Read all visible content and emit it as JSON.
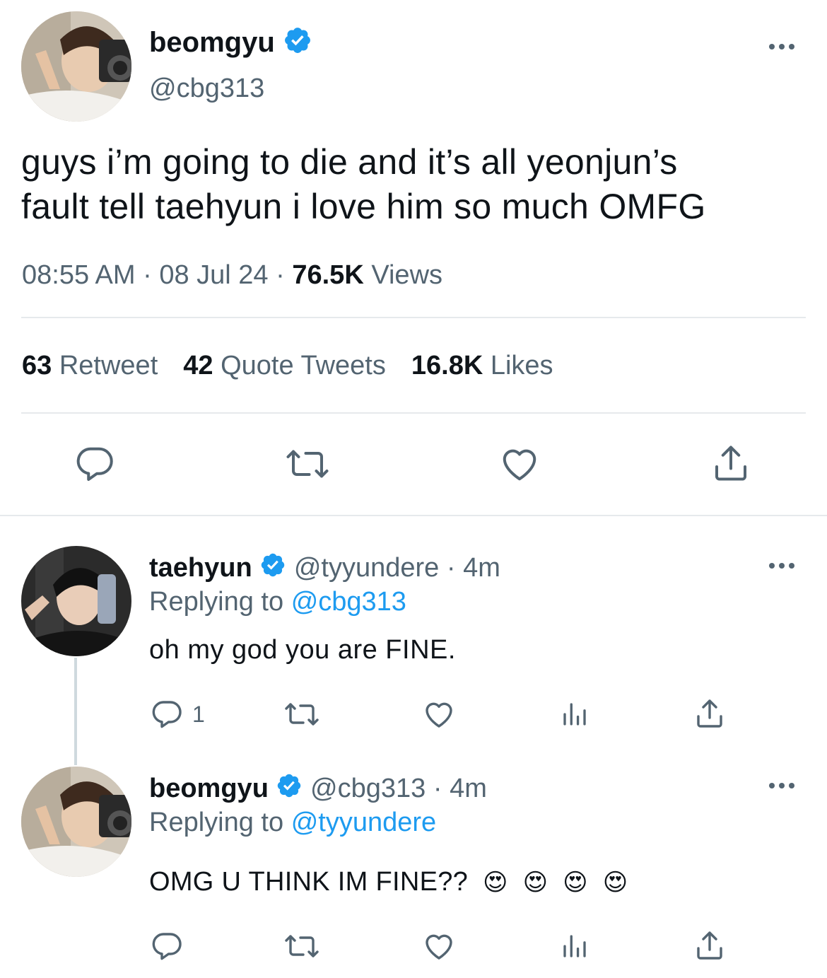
{
  "main_tweet": {
    "display_name": "beomgyu",
    "handle": "@cbg313",
    "text_line1": "guys i’m going to die and it’s all yeonjun’s",
    "text_line2": "fault tell taehyun i love him so much OMFG",
    "time": "08:55 AM",
    "sep1": "·",
    "date": "08 Jul 24",
    "sep2": "·",
    "views_count": "76.5K",
    "views_label": "Views",
    "retweets_count": "63",
    "retweets_label": "Retweet",
    "quotes_count": "42",
    "quotes_label": "Quote Tweets",
    "likes_count": "16.8K",
    "likes_label": "Likes"
  },
  "reply1": {
    "display_name": "taehyun",
    "handle": "@tyyundere",
    "sep": "·",
    "time": "4m",
    "replying_prefix": "Replying to",
    "replying_to": "@cbg313",
    "text": "oh my god you are FINE.",
    "reply_count": "1"
  },
  "reply2": {
    "display_name": "beomgyu",
    "handle": "@cbg313",
    "sep": "·",
    "time": "4m",
    "replying_prefix": "Replying to",
    "replying_to": "@tyyundere",
    "text": "OMG U THINK IM FINE??",
    "emojis": [
      "😍",
      "😍",
      "😍",
      "😍"
    ]
  },
  "colors": {
    "accent": "#1d9bf0",
    "icon_gray": "#536471",
    "text": "#0f1419",
    "divider": "#e6e9ec"
  },
  "icons": [
    "verified-badge-icon",
    "more-icon",
    "reply-icon",
    "retweet-icon",
    "like-icon",
    "share-icon",
    "analytics-icon"
  ]
}
